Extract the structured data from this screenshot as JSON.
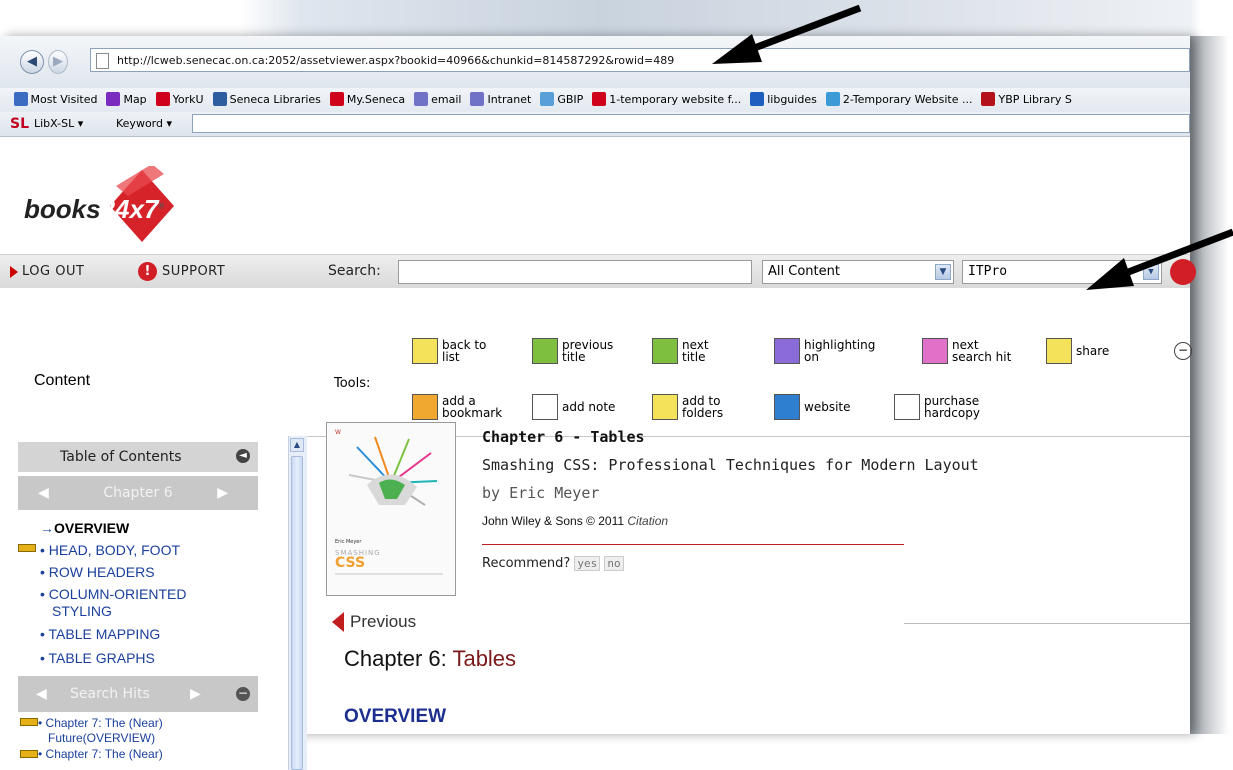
{
  "browser": {
    "url": "http://lcweb.senecac.on.ca:2052/assetviewer.aspx?bookid=40966&chunkid=814587292&rowid=489",
    "back_icon": "back-arrow-icon",
    "forward_icon": "forward-arrow-icon",
    "bookmarks": [
      {
        "label": "Most Visited",
        "icon": "most-visited-icon",
        "color": "#3b6cc2"
      },
      {
        "label": "Map",
        "icon": "map-icon",
        "color": "#7b2cbf"
      },
      {
        "label": "YorkU",
        "icon": "yorku-icon",
        "color": "#d0021b"
      },
      {
        "label": "Seneca Libraries",
        "icon": "seneca-libraries-icon",
        "color": "#2d5d9f"
      },
      {
        "label": "My.Seneca",
        "icon": "seneca-s-icon",
        "color": "#d0021b"
      },
      {
        "label": "email",
        "icon": "diamond-icon",
        "color": "#6f72c6"
      },
      {
        "label": "Intranet",
        "icon": "diamond-icon",
        "color": "#6f72c6"
      },
      {
        "label": "GBIP",
        "icon": "gbip-icon",
        "color": "#5aa0d8"
      },
      {
        "label": "1-temporary website f...",
        "icon": "seneca-s-icon",
        "color": "#d0021b"
      },
      {
        "label": "libguides",
        "icon": "libguides-icon",
        "color": "#1d5fbf"
      },
      {
        "label": "2-Temporary Website ...",
        "icon": "sparkle-icon",
        "color": "#3c9bd6"
      },
      {
        "label": "YBP Library S",
        "icon": "ybp-g-icon",
        "color": "#b3121b"
      }
    ],
    "libx_label": "LibX-SL",
    "keyword_label": "Keyword"
  },
  "brand": {
    "name_left": "books",
    "name_right": "24x7",
    "reg": "®",
    "accent": "#d6232a"
  },
  "header": {
    "logout": "LOG OUT",
    "support": "SUPPORT",
    "search_label": "Search:",
    "search_value": "",
    "scope_select": "All Content",
    "collection_select": "ITPro"
  },
  "tools": {
    "section_label": "Content",
    "tools_label": "Tools:",
    "items": [
      {
        "line1": "back to",
        "line2": "list",
        "icon": "back-to-list-icon"
      },
      {
        "line1": "previous",
        "line2": "title",
        "icon": "previous-title-icon"
      },
      {
        "line1": "next",
        "line2": "title",
        "icon": "next-title-icon"
      },
      {
        "line1": "highlighting",
        "line2": "on",
        "icon": "highlighting-icon"
      },
      {
        "line1": "next",
        "line2": "search hit",
        "icon": "next-search-hit-icon"
      },
      {
        "line1": "share",
        "line2": "",
        "icon": "envelope-icon"
      },
      {
        "line1": "add a",
        "line2": "bookmark",
        "icon": "bookmark-icon"
      },
      {
        "line1": "add note",
        "line2": "",
        "icon": "note-icon"
      },
      {
        "line1": "add to",
        "line2": "folders",
        "icon": "folder-icon"
      },
      {
        "line1": "website",
        "line2": "",
        "icon": "globe-icon"
      },
      {
        "line1": "purchase",
        "line2": "hardcopy",
        "icon": "purchase-icon"
      }
    ]
  },
  "sidebar": {
    "toc_title": "Table of Contents",
    "chapter_nav": "Chapter 6",
    "toc_items": [
      "OVERVIEW",
      "HEAD, BODY, FOOT",
      "ROW HEADERS",
      "COLUMN-ORIENTED",
      "STYLING",
      "TABLE MAPPING",
      "TABLE GRAPHS"
    ],
    "search_hits_label": "Search Hits",
    "hits": [
      "Chapter 7: The (Near)",
      "Future(OVERVIEW)",
      "Chapter 7: The (Near)"
    ]
  },
  "book": {
    "chapter": "Chapter 6 - Tables",
    "title": "Smashing CSS: Professional Techniques for Modern Layout",
    "author": "by  Eric Meyer",
    "publisher": "John Wiley & Sons © 2011",
    "citation": "Citation",
    "recommend_label": "Recommend?",
    "yes": "yes",
    "no": "no",
    "cover_series": "SMASHING",
    "cover_css": "CSS",
    "cover_author": "Eric Meyer"
  },
  "content": {
    "previous": "Previous",
    "heading_prefix": "Chapter 6: ",
    "heading_topic": "Tables",
    "section": "OVERVIEW"
  }
}
